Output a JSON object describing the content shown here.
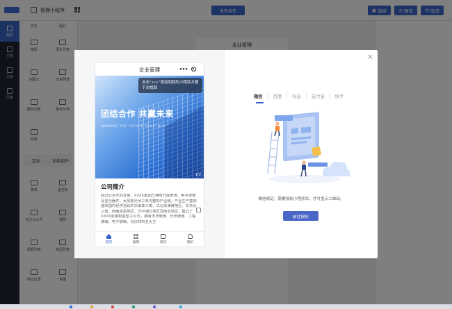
{
  "topbar": {
    "app_title": "管理小程序",
    "publish_label": "发布发布",
    "save_label": "保存",
    "preview_label": "预览",
    "cancel_label": "取消",
    "accent": "#3a66c9"
  },
  "leftnav": {
    "items": [
      {
        "label": "组件",
        "icon": "component-icon"
      },
      {
        "label": "主题",
        "icon": "list-icon"
      },
      {
        "label": "页面",
        "icon": "page-icon"
      },
      {
        "label": "风格",
        "icon": "style-icon"
      }
    ]
  },
  "palette": {
    "rows": [
      [
        "文本",
        "图片"
      ],
      [
        "按钮",
        "图片列表"
      ],
      [
        "多图文",
        "文章列表"
      ],
      [
        "服务列表",
        "服务分类"
      ],
      [
        "标题",
        ""
      ]
    ],
    "tabs": [
      "互动",
      "功能组件"
    ],
    "rows2": [
      [
        "表单",
        "留言板"
      ],
      [
        "关注公众号",
        "视频"
      ],
      [
        "视频列表",
        "商品列表"
      ],
      [
        "地址位置",
        "地图"
      ]
    ]
  },
  "canvas": {
    "title": "企业管理"
  },
  "modal": {
    "close_label": "×",
    "phone": {
      "title": "企业管理",
      "tip": "点击“•••”添加到我的小程序方便下次找回",
      "slogan": "团结合作 共赢未来",
      "slogan_en": "WINNING THE FUTURE TOGETHER",
      "pager": "1/2",
      "intro_title": "公司简介",
      "intro_body": "经过近多年的发展，XXXX集团已拥有节能玻璃、电子玻璃及显示器件、太阳能光伏三条完整的产业链，产业生产基地遍布国内经济活跃的华南珠三角、华北京津冀地区、华东长三角、西南成渝地区、华中湖北地区及西北地区，建立了XXXX余家制造型子公司，拥有浮法玻璃、光伏玻璃、工程玻璃、电子玻璃、光伏材料五大主",
      "tabs": [
        {
          "label": "首页",
          "icon": "home-icon",
          "active": true
        },
        {
          "label": "案例",
          "icon": "grid-icon",
          "active": false
        },
        {
          "label": "资讯",
          "icon": "news-icon",
          "active": false
        },
        {
          "label": "我们",
          "icon": "user-icon",
          "active": false
        }
      ]
    },
    "platforms": [
      "微信",
      "百度",
      "抖音",
      "支付宝",
      "快手"
    ],
    "active_platform": "微信",
    "hint": "微信规定，需要授权小程序后，才可显示二维码。",
    "auth_button": "前往授权",
    "colors": {
      "button": "#4a66c6",
      "illustration": "#8fb2f0"
    }
  }
}
